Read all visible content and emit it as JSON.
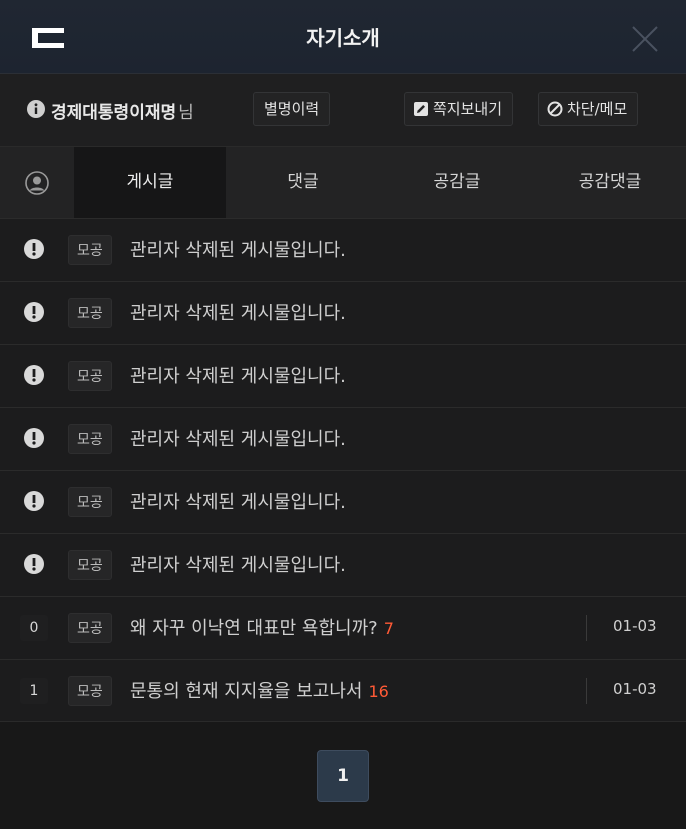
{
  "header": {
    "title": "자기소개"
  },
  "user": {
    "nickname": "경제대통령이재명",
    "suffix": "님",
    "history_button": "별명이력",
    "message_button": "쪽지보내기",
    "block_button": "차단/메모"
  },
  "tabs": [
    {
      "label": "게시글",
      "active": true
    },
    {
      "label": "댓글",
      "active": false
    },
    {
      "label": "공감글",
      "active": false
    },
    {
      "label": "공감댓글",
      "active": false
    }
  ],
  "deleted_posts": [
    {
      "board": "모공",
      "text": "관리자 삭제된 게시물입니다."
    },
    {
      "board": "모공",
      "text": "관리자 삭제된 게시물입니다."
    },
    {
      "board": "모공",
      "text": "관리자 삭제된 게시물입니다."
    },
    {
      "board": "모공",
      "text": "관리자 삭제된 게시물입니다."
    },
    {
      "board": "모공",
      "text": "관리자 삭제된 게시물입니다."
    },
    {
      "board": "모공",
      "text": "관리자 삭제된 게시물입니다."
    }
  ],
  "posts": [
    {
      "number": "0",
      "board": "모공",
      "title": "왜 자꾸 이낙연 대표만 욕합니까?",
      "comments": "7",
      "date": "01-03"
    },
    {
      "number": "1",
      "board": "모공",
      "title": "문통의 현재 지지율을 보고나서",
      "comments": "16",
      "date": "01-03"
    }
  ],
  "pagination": {
    "current": "1"
  },
  "colors": {
    "header_bg": "#1f2631",
    "comment_count": "#ff5a36",
    "page_active": "#2c3a4a"
  }
}
